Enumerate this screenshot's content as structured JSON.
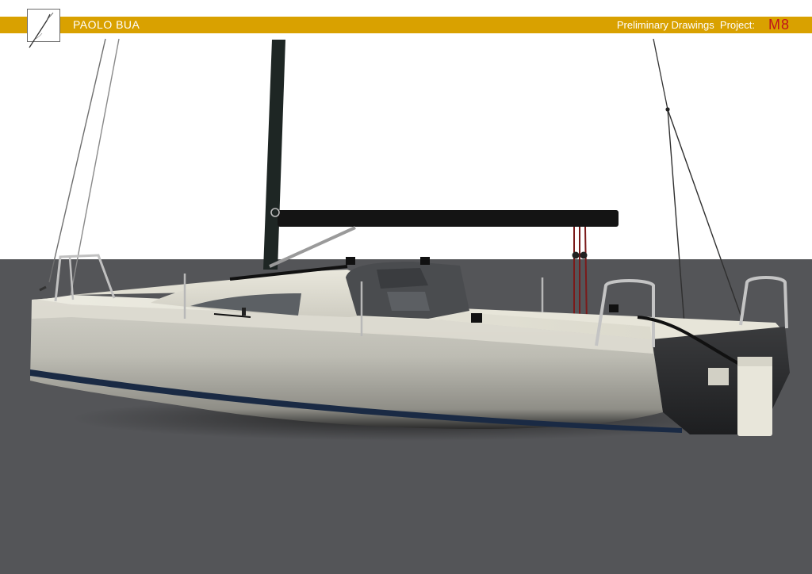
{
  "header": {
    "brand": "PAOLO BUA",
    "subtitle": "Preliminary Drawings  Project:",
    "project_code": "M8"
  },
  "colors": {
    "header_bar": "#d9a100",
    "project_code": "#c0141c",
    "ground": "#545558",
    "sky": "#ffffff",
    "hull": "#c9c8c0",
    "deck": "#e4e2d6",
    "mast": "#1e2624",
    "boom": "#141414"
  },
  "icons": {
    "logo": "pen-signature-logo"
  }
}
